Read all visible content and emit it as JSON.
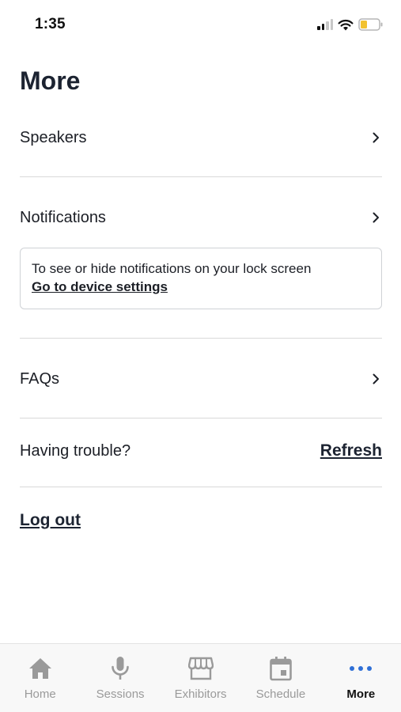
{
  "status_bar": {
    "time": "1:35"
  },
  "page": {
    "title": "More"
  },
  "menu": {
    "speakers_label": "Speakers",
    "notifications_label": "Notifications",
    "faqs_label": "FAQs"
  },
  "notifications_card": {
    "info_text": "To see or hide notifications on your lock screen",
    "link_text": "Go to device settings"
  },
  "trouble": {
    "label": "Having trouble?",
    "refresh_label": "Refresh"
  },
  "logout_label": "Log out",
  "tab_bar": {
    "tabs": [
      {
        "label": "Home",
        "icon": "home-icon"
      },
      {
        "label": "Sessions",
        "icon": "microphone-icon"
      },
      {
        "label": "Exhibitors",
        "icon": "storefront-icon"
      },
      {
        "label": "Schedule",
        "icon": "calendar-icon"
      },
      {
        "label": "More",
        "icon": "more-dots-icon",
        "active": true
      }
    ]
  },
  "colors": {
    "text": "#1c1f26",
    "title": "#1c2331",
    "inactive_tab": "#9a9a9a",
    "active_dots": "#2f6fd6",
    "battery_fill": "#f2c230",
    "divider": "#d9d9d9"
  }
}
